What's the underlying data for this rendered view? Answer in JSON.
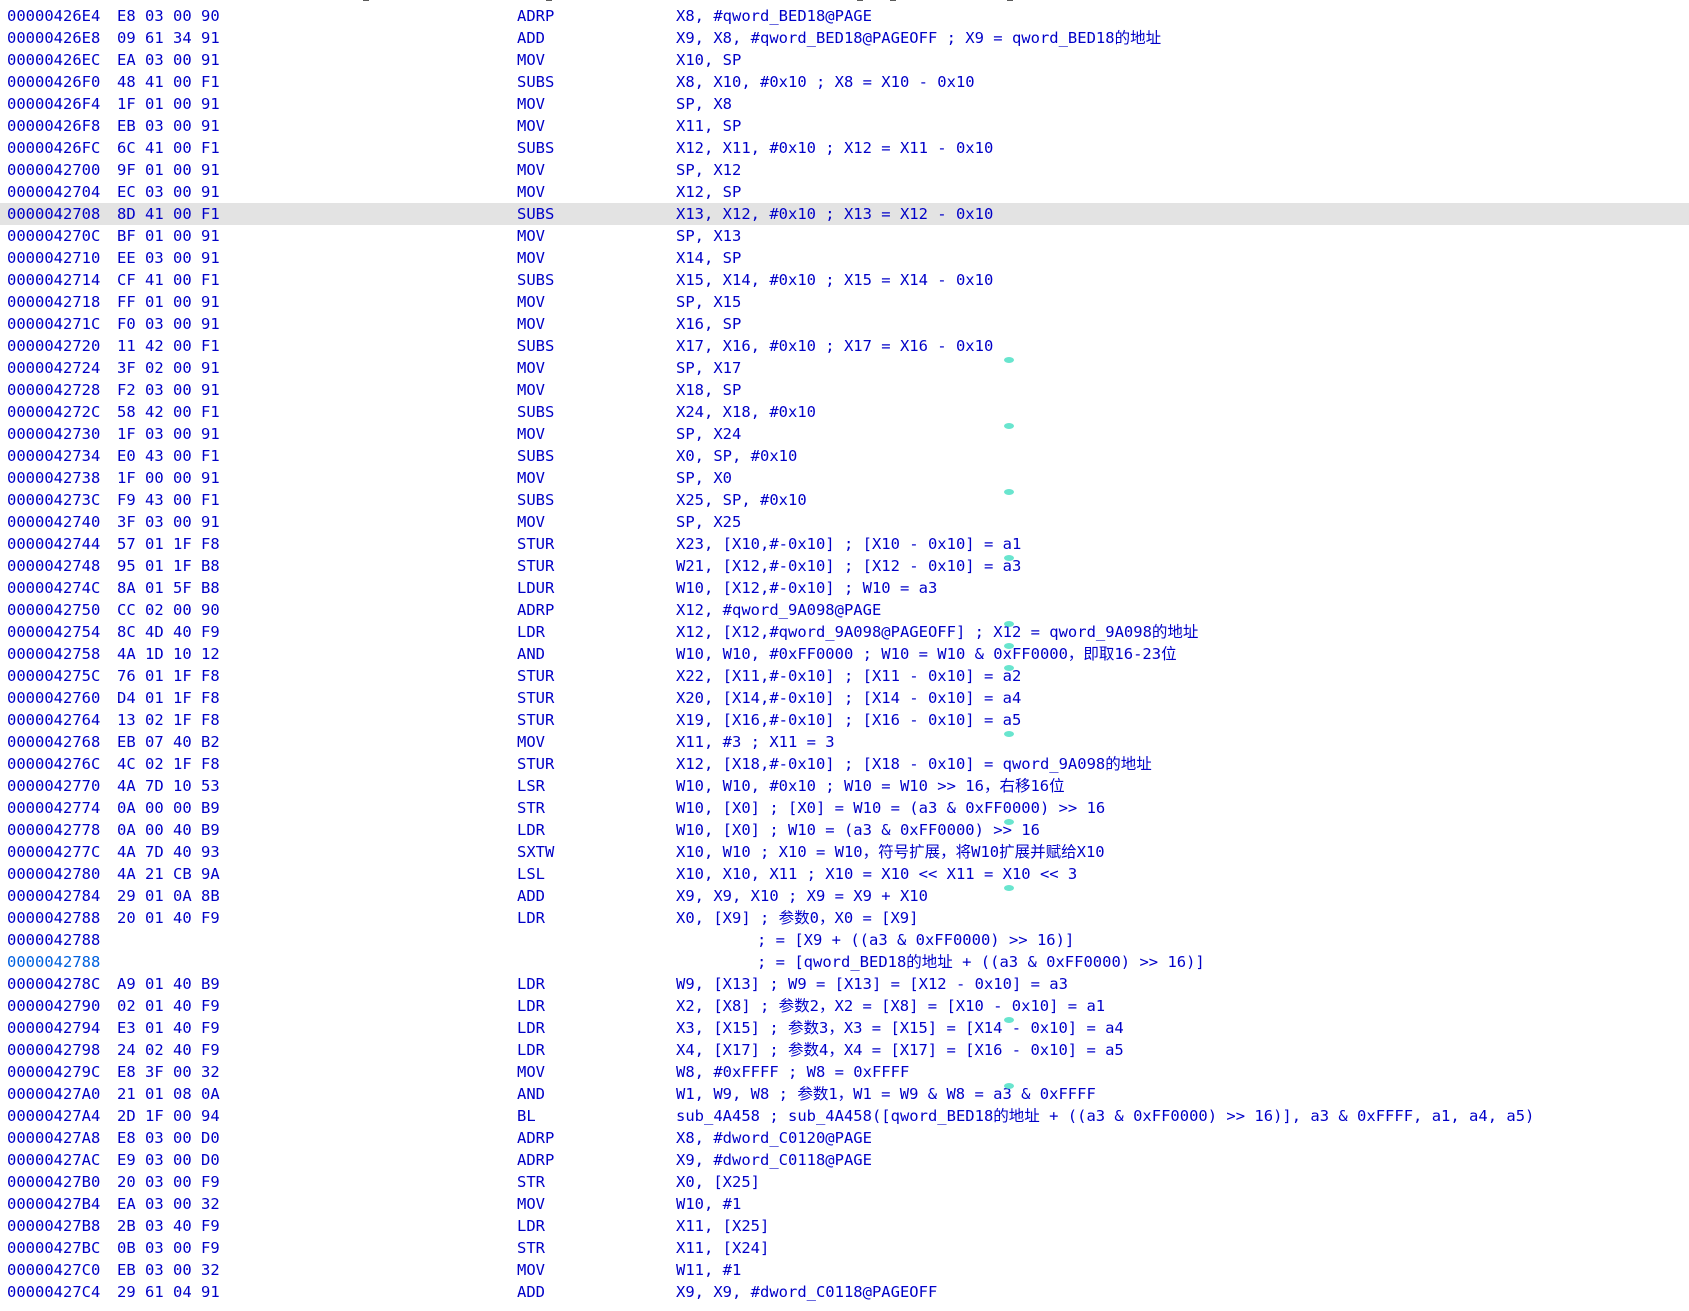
{
  "colors": {
    "text": "#0000c8",
    "selected_row_bg": "#e3e3e3",
    "selected_addr": "#0060e0",
    "immediate_green": "#008000",
    "immediate_orange": "#ff8000",
    "cursor_marker": "#4fe0c6"
  },
  "rows": [
    {
      "addr": "00000426E4",
      "bytes": "E8 03 00 90",
      "mnem": "ADRP",
      "ops": "X8, #qword_BED18@PAGE"
    },
    {
      "addr": "00000426E8",
      "bytes": "09 61 34 91",
      "mnem": "ADD",
      "ops": "X9, X8, #qword_BED18@PAGEOFF ; X9 = qword_BED18的地址"
    },
    {
      "addr": "00000426EC",
      "bytes": "EA 03 00 91",
      "mnem": "MOV",
      "ops": "X10, SP"
    },
    {
      "addr": "00000426F0",
      "bytes": "48 41 00 F1",
      "mnem": "SUBS",
      "ops": "X8, X10, #0x10 ; X8 = X10 - 0x10"
    },
    {
      "addr": "00000426F4",
      "bytes": "1F 01 00 91",
      "mnem": "MOV",
      "ops": "SP, X8"
    },
    {
      "addr": "00000426F8",
      "bytes": "EB 03 00 91",
      "mnem": "MOV",
      "ops": "X11, SP"
    },
    {
      "addr": "00000426FC",
      "bytes": "6C 41 00 F1",
      "mnem": "SUBS",
      "ops": "X12, X11, #0x10 ; X12 = X11 - 0x10"
    },
    {
      "addr": "0000042700",
      "bytes": "9F 01 00 91",
      "mnem": "MOV",
      "ops": "SP, X12"
    },
    {
      "addr": "0000042704",
      "bytes": "EC 03 00 91",
      "mnem": "MOV",
      "ops": "X12, SP"
    },
    {
      "addr": "0000042708",
      "bytes": "8D 41 00 F1",
      "mnem": "SUBS",
      "ops": "X13, X12, #0x10 ; X13 = X12 - 0x10"
    },
    {
      "addr": "000004270C",
      "bytes": "BF 01 00 91",
      "mnem": "MOV",
      "ops": "SP, X13"
    },
    {
      "addr": "0000042710",
      "bytes": "EE 03 00 91",
      "mnem": "MOV",
      "ops": "X14, SP"
    },
    {
      "addr": "0000042714",
      "bytes": "CF 41 00 F1",
      "mnem": "SUBS",
      "ops": "X15, X14, #0x10 ; X15 = X14 - 0x10"
    },
    {
      "addr": "0000042718",
      "bytes": "FF 01 00 91",
      "mnem": "MOV",
      "ops": "SP, X15"
    },
    {
      "addr": "000004271C",
      "bytes": "F0 03 00 91",
      "mnem": "MOV",
      "ops": "X16, SP"
    },
    {
      "addr": "0000042720",
      "bytes": "11 42 00 F1",
      "mnem": "SUBS",
      "ops": "X17, X16, #0x10 ; X17 = X16 - 0x10"
    },
    {
      "addr": "0000042724",
      "bytes": "3F 02 00 91",
      "mnem": "MOV",
      "ops": "SP, X17"
    },
    {
      "addr": "0000042728",
      "bytes": "F2 03 00 91",
      "mnem": "MOV",
      "ops": "X18, SP"
    },
    {
      "addr": "000004272C",
      "bytes": "58 42 00 F1",
      "mnem": "SUBS",
      "ops": "X24, X18, #0x10"
    },
    {
      "addr": "0000042730",
      "bytes": "1F 03 00 91",
      "mnem": "MOV",
      "ops": "SP, X24"
    },
    {
      "addr": "0000042734",
      "bytes": "E0 43 00 F1",
      "mnem": "SUBS",
      "ops": "X0, SP, #0x10"
    },
    {
      "addr": "0000042738",
      "bytes": "1F 00 00 91",
      "mnem": "MOV",
      "ops": "SP, X0"
    },
    {
      "addr": "000004273C",
      "bytes": "F9 43 00 F1",
      "mnem": "SUBS",
      "ops": "X25, SP, #0x10"
    },
    {
      "addr": "0000042740",
      "bytes": "3F 03 00 91",
      "mnem": "MOV",
      "ops": "SP, X25"
    },
    {
      "addr": "0000042744",
      "bytes": "57 01 1F F8",
      "mnem": "STUR",
      "ops": "X23, [X10,#-0x10] ; [X10 - 0x10] = a1"
    },
    {
      "addr": "0000042748",
      "bytes": "95 01 1F B8",
      "mnem": "STUR",
      "ops": "W21, [X12,#-0x10] ; [X12 - 0x10] = a3"
    },
    {
      "addr": "000004274C",
      "bytes": "8A 01 5F B8",
      "mnem": "LDUR",
      "ops": "W10, [X12,#-0x10] ; W10 = a3"
    },
    {
      "addr": "0000042750",
      "bytes": "CC 02 00 90",
      "mnem": "ADRP",
      "ops": "X12, #qword_9A098@PAGE"
    },
    {
      "addr": "0000042754",
      "bytes": "8C 4D 40 F9",
      "mnem": "LDR",
      "ops": "X12, [X12,#qword_9A098@PAGEOFF] ; X12 = qword_9A098的地址"
    },
    {
      "addr": "0000042758",
      "bytes": "4A 1D 10 12",
      "mnem": "AND",
      "ops": "W10, W10, #0xFF0000 ; W10 = W10 & 0xFF0000，即取16-23位"
    },
    {
      "addr": "000004275C",
      "bytes": "76 01 1F F8",
      "mnem": "STUR",
      "ops": "X22, [X11,#-0x10] ; [X11 - 0x10] = a2"
    },
    {
      "addr": "0000042760",
      "bytes": "D4 01 1F F8",
      "mnem": "STUR",
      "ops": "X20, [X14,#-0x10] ; [X14 - 0x10] = a4"
    },
    {
      "addr": "0000042764",
      "bytes": "13 02 1F F8",
      "mnem": "STUR",
      "ops": "X19, [X16,#-0x10] ; [X16 - 0x10] = a5"
    },
    {
      "addr": "0000042768",
      "bytes": "EB 07 40 B2",
      "mnem": "MOV",
      "ops": "X11, #3 ; X11 = 3"
    },
    {
      "addr": "000004276C",
      "bytes": "4C 02 1F F8",
      "mnem": "STUR",
      "ops": "X12, [X18,#-0x10] ; [X18 - 0x10] = qword_9A098的地址"
    },
    {
      "addr": "0000042770",
      "bytes": "4A 7D 10 53",
      "mnem": "LSR",
      "ops": "W10, W10, #0x10 ; W10 = W10 >> 16，右移16位"
    },
    {
      "addr": "0000042774",
      "bytes": "0A 00 00 B9",
      "mnem": "STR",
      "ops": "W10, [X0] ; [X0] = W10 = (a3 & 0xFF0000) >> 16"
    },
    {
      "addr": "0000042778",
      "bytes": "0A 00 40 B9",
      "mnem": "LDR",
      "ops": "W10, [X0] ; W10 = (a3 & 0xFF0000) >> 16"
    },
    {
      "addr": "000004277C",
      "bytes": "4A 7D 40 93",
      "mnem": "SXTW",
      "ops": "X10, W10 ; X10 = W10，符号扩展，将W10扩展并赋给X10"
    },
    {
      "addr": "0000042780",
      "bytes": "4A 21 CB 9A",
      "mnem": "LSL",
      "ops": "X10, X10, X11 ; X10 = X10 << X11 = X10 << 3"
    },
    {
      "addr": "0000042784",
      "bytes": "29 01 0A 8B",
      "mnem": "ADD",
      "ops": "X9, X9, X10 ; X9 = X9 + X10"
    },
    {
      "addr": "0000042788",
      "bytes": "20 01 40 F9",
      "mnem": "LDR",
      "ops": "X0, [X9] ; 参数0，X0 = [X9]"
    },
    {
      "addr": "0000042788",
      "bytes": "",
      "mnem": "",
      "ops": "",
      "comment": "; = [X9 + ((a3 & 0xFF0000) >> 16)]"
    },
    {
      "addr": "0000042788",
      "bytes": "",
      "mnem": "",
      "ops": "",
      "comment": "; = [qword_BED18的地址 + ((a3 & 0xFF0000) >> 16)]"
    },
    {
      "addr": "000004278C",
      "bytes": "A9 01 40 B9",
      "mnem": "LDR",
      "ops": "W9, [X13] ; W9 = [X13] = [X12 - 0x10] = a3"
    },
    {
      "addr": "0000042790",
      "bytes": "02 01 40 F9",
      "mnem": "LDR",
      "ops": "X2, [X8] ; 参数2，X2 = [X8] = [X10 - 0x10] = a1"
    },
    {
      "addr": "0000042794",
      "bytes": "E3 01 40 F9",
      "mnem": "LDR",
      "ops": "X3, [X15] ; 参数3，X3 = [X15] = [X14 - 0x10] = a4"
    },
    {
      "addr": "0000042798",
      "bytes": "24 02 40 F9",
      "mnem": "LDR",
      "ops": "X4, [X17] ; 参数4，X4 = [X17] = [X16 - 0x10] = a5"
    },
    {
      "addr": "000004279C",
      "bytes": "E8 3F 00 32",
      "mnem": "MOV",
      "ops": "W8, #0xFFFF ; W8 = 0xFFFF"
    },
    {
      "addr": "00000427A0",
      "bytes": "21 01 08 0A",
      "mnem": "AND",
      "ops": "W1, W9, W8 ; 参数1，W1 = W9 & W8 = a3 & 0xFFFF"
    },
    {
      "addr": "00000427A4",
      "bytes": "2D 1F 00 94",
      "mnem": "BL",
      "ops": "sub_4A458 ; sub_4A458([qword_BED18的地址 + ((a3 & 0xFF0000) >> 16)], a3 & 0xFFFF, a1, a4, a5)"
    },
    {
      "addr": "00000427A8",
      "bytes": "E8 03 00 D0",
      "mnem": "ADRP",
      "ops": "X8, #dword_C0120@PAGE"
    },
    {
      "addr": "00000427AC",
      "bytes": "E9 03 00 D0",
      "mnem": "ADRP",
      "ops": "X9, #dword_C0118@PAGE"
    },
    {
      "addr": "00000427B0",
      "bytes": "20 03 00 F9",
      "mnem": "STR",
      "ops": "X0, [X25]"
    },
    {
      "addr": "00000427B4",
      "bytes": "EA 03 00 32",
      "mnem": "MOV",
      "ops": "W10, #1"
    },
    {
      "addr": "00000427B8",
      "bytes": "2B 03 40 F9",
      "mnem": "LDR",
      "ops": "X11, [X25]"
    },
    {
      "addr": "00000427BC",
      "bytes": "0B 03 00 F9",
      "mnem": "STR",
      "ops": "X11, [X24]"
    },
    {
      "addr": "00000427C0",
      "bytes": "EB 03 00 32",
      "mnem": "MOV",
      "ops": "W11, #1"
    },
    {
      "addr": "00000427C4",
      "bytes": "29 61 04 91",
      "mnem": "ADD",
      "ops": "X9, X9, #dword_C0118@PAGEOFF"
    }
  ]
}
